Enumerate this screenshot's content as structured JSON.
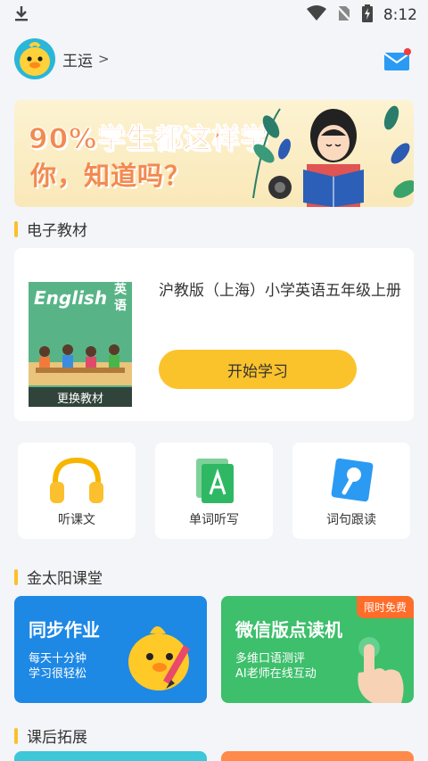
{
  "status_bar": {
    "time": "8:12"
  },
  "header": {
    "username": "王运",
    "arrow": ">"
  },
  "banner": {
    "line1": "90%学生都这样学",
    "line2": "你，知道吗？"
  },
  "sections": {
    "textbook": "电子教材",
    "classroom": "金太阳课堂",
    "extension": "课后拓展"
  },
  "textbook": {
    "cover_title_en": "English",
    "cover_title_cn": "英语",
    "change_label": "更换教材",
    "book_title": "沪教版（上海）小学英语五年级上册",
    "start_button": "开始学习"
  },
  "tools": [
    {
      "label": "听课文",
      "icon": "headphones-icon"
    },
    {
      "label": "单词听写",
      "icon": "dictation-icon"
    },
    {
      "label": "词句跟读",
      "icon": "microphone-icon"
    }
  ],
  "courses": [
    {
      "title": "同步作业",
      "subtitle1": "每天十分钟",
      "subtitle2": "学习很轻松",
      "color": "#1e88e5"
    },
    {
      "title": "微信版点读机",
      "subtitle1": "多维口语测评",
      "subtitle2": "AI老师在线互动",
      "badge": "限时免费",
      "color": "#3dbf6b"
    }
  ]
}
